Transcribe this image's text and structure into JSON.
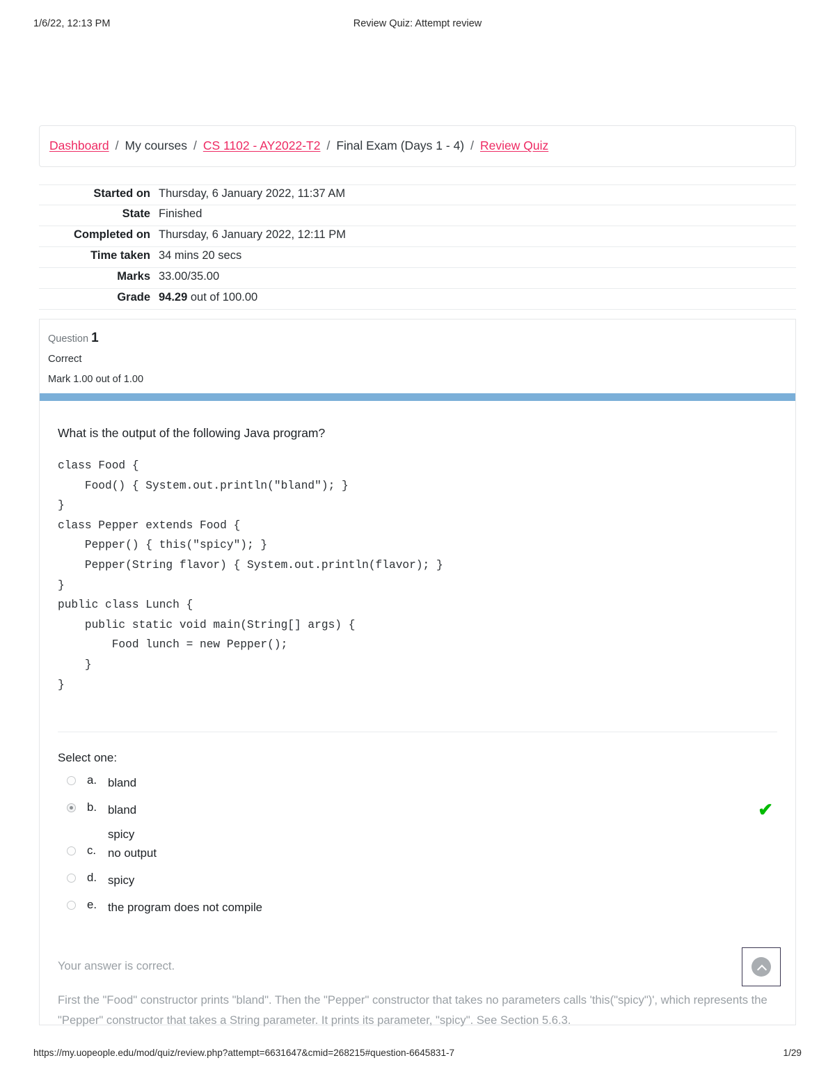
{
  "print_header": {
    "date": "1/6/22, 12:13 PM",
    "title": "Review Quiz: Attempt review"
  },
  "breadcrumb": {
    "separator": "/",
    "items": [
      {
        "label": "Dashboard",
        "is_link": true
      },
      {
        "label": "My courses",
        "is_link": false
      },
      {
        "label": "CS 1102 - AY2022-T2",
        "is_link": true
      },
      {
        "label": "Final Exam (Days 1 - 4)",
        "is_link": false
      },
      {
        "label": "Review Quiz",
        "is_link": true
      }
    ]
  },
  "summary": {
    "rows": [
      {
        "label": "Started on",
        "value": "Thursday, 6 January 2022, 11:37 AM"
      },
      {
        "label": "State",
        "value": "Finished"
      },
      {
        "label": "Completed on",
        "value": "Thursday, 6 January 2022, 12:11 PM"
      },
      {
        "label": "Time taken",
        "value": "34 mins 20 secs"
      },
      {
        "label": "Marks",
        "value": "33.00/35.00"
      }
    ],
    "grade": {
      "label": "Grade",
      "score": "94.29",
      "suffix": " out of 100.00"
    }
  },
  "question": {
    "number_label": "Question",
    "number": "1",
    "state": "Correct",
    "mark": "Mark 1.00 out of 1.00",
    "accent_color": "#7bafd8",
    "prompt": "What is the output of the following Java program?",
    "code": "class Food {\n    Food() { System.out.println(\"bland\"); }\n}\nclass Pepper extends Food {\n    Pepper() { this(\"spicy\"); }\n    Pepper(String flavor) { System.out.println(flavor); }\n}\npublic class Lunch {\n    public static void main(String[] args) {\n        Food lunch = new Pepper();\n    }\n}",
    "select_one_label": "Select one:",
    "options": [
      {
        "letter": "a.",
        "text": "bland",
        "text_line2": "",
        "selected": false,
        "correct": false
      },
      {
        "letter": "b.",
        "text": "bland",
        "text_line2": "spicy",
        "selected": true,
        "correct": true
      },
      {
        "letter": "c.",
        "text": "no output",
        "text_line2": "",
        "selected": false,
        "correct": false
      },
      {
        "letter": "d.",
        "text": "spicy",
        "text_line2": "",
        "selected": false,
        "correct": false
      },
      {
        "letter": "e.",
        "text": "the program does not compile",
        "text_line2": "",
        "selected": false,
        "correct": false
      }
    ],
    "correct_icon": "✔",
    "feedback_heading": "Your answer is correct.",
    "feedback_body": "First the \"Food\" constructor prints \"bland\". Then the \"Pepper\" constructor that takes no parameters calls 'this(\"spicy\")', which represents the \"Pepper\" constructor that takes a String parameter. It prints its parameter, \"spicy\". See Section 5.6.3."
  },
  "scroll_top_button": {
    "icon": "chevron-up-icon"
  },
  "print_footer": {
    "url": "https://my.uopeople.edu/mod/quiz/review.php?attempt=6631647&cmid=268215#question-6645831-7",
    "page": "1/29"
  },
  "colors": {
    "link": "#ee2a63",
    "accent_bar": "#7bafd8",
    "correct_green": "#00bb00"
  }
}
